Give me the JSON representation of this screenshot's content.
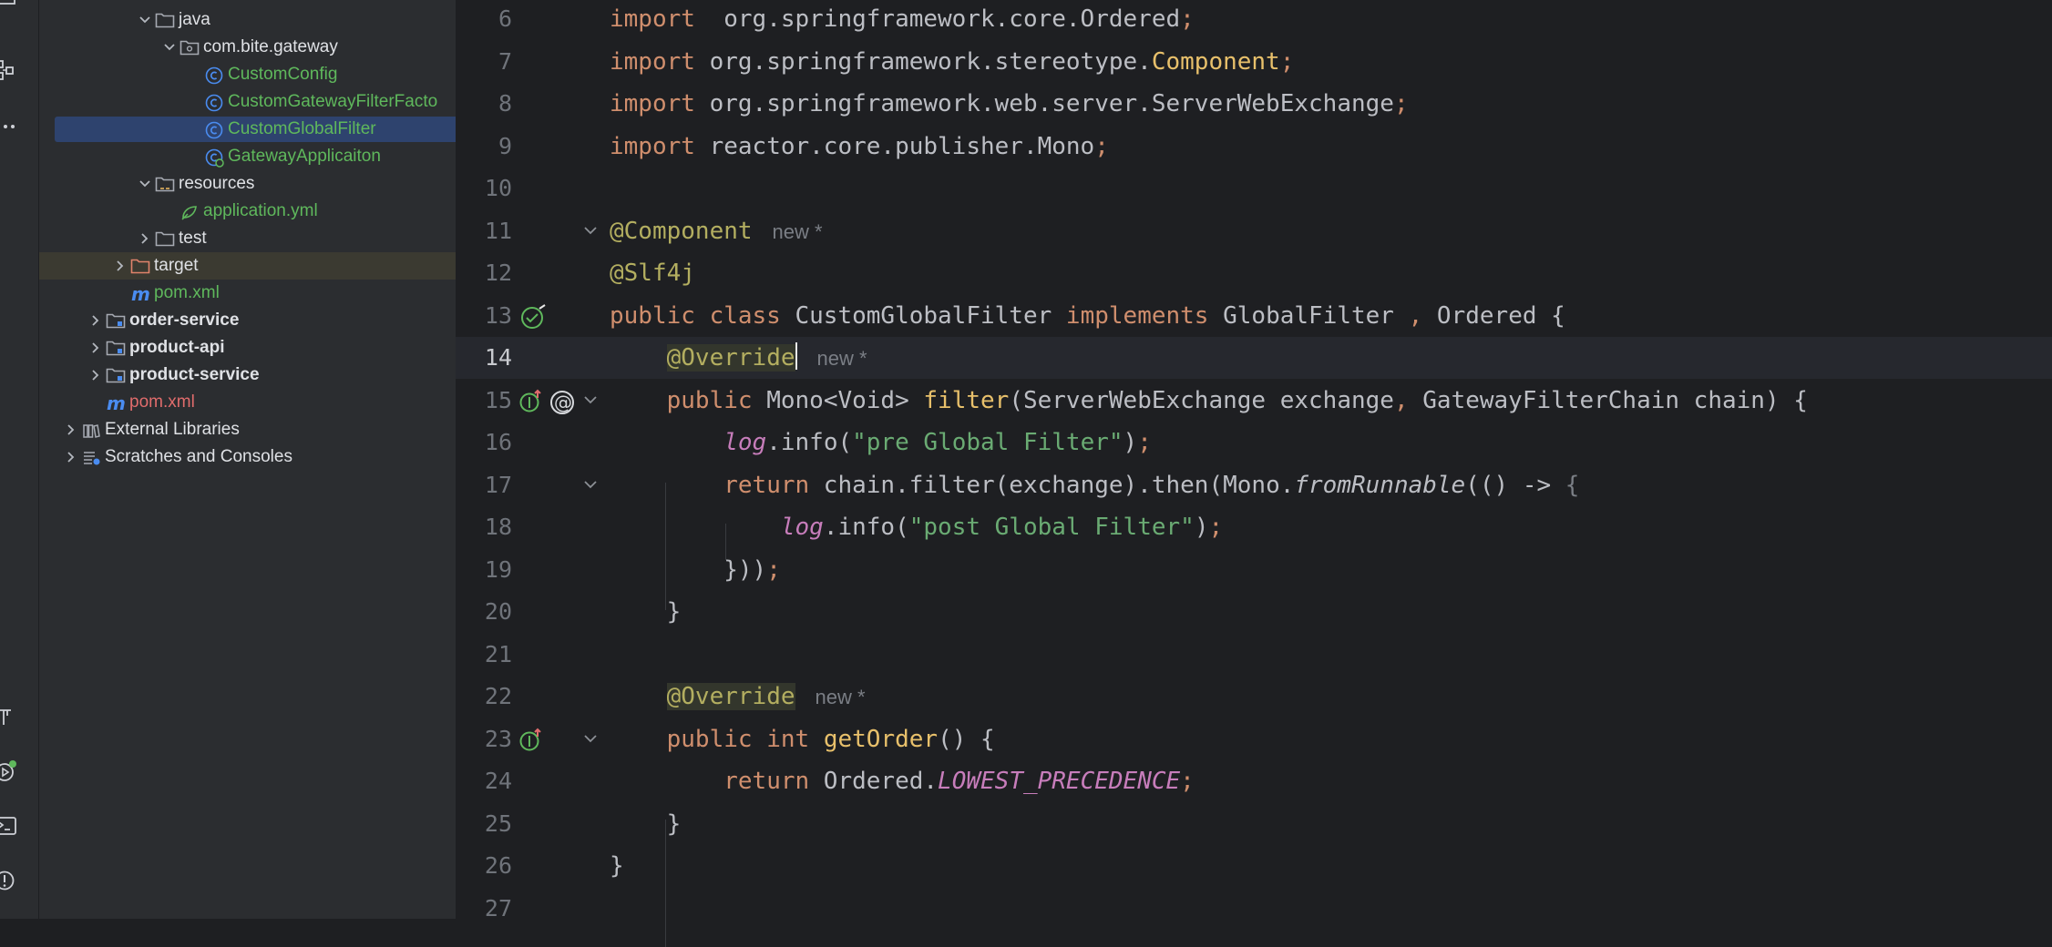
{
  "project_tree": [
    {
      "label": "java",
      "indent": 1,
      "chevron": "down",
      "icon": "folder-icon",
      "style": ""
    },
    {
      "label": "com.bite.gateway",
      "indent": 2,
      "chevron": "down",
      "icon": "package-icon",
      "style": ""
    },
    {
      "label": "CustomConfig",
      "indent": 3,
      "chevron": "",
      "icon": "class-icon",
      "style": "green"
    },
    {
      "label": "CustomGatewayFilterFacto",
      "indent": 3,
      "chevron": "",
      "icon": "class-icon",
      "style": "green"
    },
    {
      "label": "CustomGlobalFilter",
      "indent": 3,
      "chevron": "",
      "icon": "class-icon",
      "style": "green",
      "selected": true
    },
    {
      "label": "GatewayApplicaiton",
      "indent": 3,
      "chevron": "",
      "icon": "spring-class-icon",
      "style": "green"
    },
    {
      "label": "resources",
      "indent": 1,
      "chevron": "down",
      "icon": "resources-folder-icon",
      "style": ""
    },
    {
      "label": "application.yml",
      "indent": 2,
      "chevron": "",
      "icon": "yaml-icon",
      "style": "green"
    },
    {
      "label": "test",
      "indent": 1,
      "chevron": "right",
      "icon": "folder-icon",
      "style": ""
    },
    {
      "label": "target",
      "indent": 0,
      "chevron": "right",
      "icon": "excluded-folder-icon",
      "style": "",
      "excluded": true
    },
    {
      "label": "pom.xml",
      "indent": 0,
      "chevron": "",
      "icon": "maven-icon",
      "style": "green"
    },
    {
      "label": "order-service",
      "indent": -1,
      "chevron": "right",
      "icon": "module-folder-icon",
      "style": "bold"
    },
    {
      "label": "product-api",
      "indent": -1,
      "chevron": "right",
      "icon": "module-folder-icon",
      "style": "bold"
    },
    {
      "label": "product-service",
      "indent": -1,
      "chevron": "right",
      "icon": "module-folder-icon",
      "style": "bold"
    },
    {
      "label": "pom.xml",
      "indent": -1,
      "chevron": "",
      "icon": "maven-icon",
      "style": "red"
    },
    {
      "label": "External Libraries",
      "indent": -2,
      "chevron": "right",
      "icon": "libraries-icon",
      "style": ""
    },
    {
      "label": "Scratches and Consoles",
      "indent": -2,
      "chevron": "right",
      "icon": "scratches-icon",
      "style": ""
    }
  ],
  "toolstrip": [
    "project-tool-icon",
    "structure-icon",
    "more-icon",
    "build-icon",
    "run-services-icon",
    "terminal-icon",
    "problems-icon"
  ],
  "code_lines": [
    {
      "n": "6",
      "tokens": [
        [
          "kw",
          "import"
        ],
        [
          "",
          "  org.springframework.core.Ordered"
        ],
        [
          "semi",
          ";"
        ]
      ]
    },
    {
      "n": "7",
      "tokens": [
        [
          "kw",
          "import"
        ],
        [
          "",
          " org.springframework.stereotype."
        ],
        [
          "mth",
          "Component"
        ],
        [
          "semi",
          ";"
        ]
      ]
    },
    {
      "n": "8",
      "tokens": [
        [
          "kw",
          "import"
        ],
        [
          "",
          " org.springframework.web.server.ServerWebExchange"
        ],
        [
          "semi",
          ";"
        ]
      ]
    },
    {
      "n": "9",
      "tokens": [
        [
          "kw",
          "import"
        ],
        [
          "",
          " reactor.core.publisher.Mono"
        ],
        [
          "semi",
          ";"
        ]
      ]
    },
    {
      "n": "10",
      "tokens": []
    },
    {
      "n": "11",
      "tokens": [
        [
          "ann",
          "@Component"
        ],
        [
          "hint",
          "new *"
        ]
      ],
      "fold": true
    },
    {
      "n": "12",
      "tokens": [
        [
          "ann",
          "@Slf4j"
        ]
      ]
    },
    {
      "n": "13",
      "tokens": [
        [
          "kw",
          "public class"
        ],
        [
          "",
          " CustomGlobalFilter "
        ],
        [
          "kw",
          "implements"
        ],
        [
          "",
          " GlobalFilter "
        ],
        [
          "kw",
          ","
        ],
        [
          "",
          " Ordered {"
        ]
      ],
      "gutter": "bean-icon"
    },
    {
      "n": "14",
      "tokens": [
        [
          "",
          "    "
        ],
        [
          "ann ovr",
          "@Override"
        ],
        [
          "caret",
          ""
        ],
        [
          "hint",
          "new *"
        ]
      ],
      "current": true
    },
    {
      "n": "15",
      "tokens": [
        [
          "",
          "    "
        ],
        [
          "kw",
          "public"
        ],
        [
          "",
          " Mono<Void> "
        ],
        [
          "mth",
          "filter"
        ],
        [
          "",
          "(ServerWebExchange exchange"
        ],
        [
          "kw",
          ","
        ],
        [
          "",
          " GatewayFilterChain chain) {"
        ]
      ],
      "gutter": "implements-override-icon",
      "fold": true
    },
    {
      "n": "16",
      "tokens": [
        [
          "",
          "        "
        ],
        [
          "logv",
          "log"
        ],
        [
          "",
          ".info("
        ],
        [
          "str",
          "\"pre Global Filter\""
        ],
        [
          "",
          ")"
        ],
        [
          "semi",
          ";"
        ]
      ]
    },
    {
      "n": "17",
      "tokens": [
        [
          "",
          "        "
        ],
        [
          "kw",
          "return"
        ],
        [
          "",
          " chain.filter(exchange).then(Mono."
        ],
        [
          "itf",
          "fromRunnable"
        ],
        [
          "",
          "(() -> "
        ],
        [
          "gry",
          "{"
        ]
      ],
      "fold": true
    },
    {
      "n": "18",
      "tokens": [
        [
          "",
          "            "
        ],
        [
          "logv",
          "log"
        ],
        [
          "",
          ".info("
        ],
        [
          "str",
          "\"post Global Filter\""
        ],
        [
          "",
          ")"
        ],
        [
          "semi",
          ";"
        ]
      ]
    },
    {
      "n": "19",
      "tokens": [
        [
          "",
          "        })"
        ],
        [
          "",
          ")"
        ],
        [
          "semi",
          ";"
        ]
      ]
    },
    {
      "n": "20",
      "tokens": [
        [
          "",
          "    }"
        ]
      ]
    },
    {
      "n": "21",
      "tokens": []
    },
    {
      "n": "22",
      "tokens": [
        [
          "",
          "    "
        ],
        [
          "ann ovr",
          "@Override"
        ],
        [
          "hint",
          "new *"
        ]
      ]
    },
    {
      "n": "23",
      "tokens": [
        [
          "",
          "    "
        ],
        [
          "kw",
          "public int"
        ],
        [
          "",
          " "
        ],
        [
          "mth",
          "getOrder"
        ],
        [
          "",
          "() {"
        ]
      ],
      "gutter": "implements-icon",
      "fold": true
    },
    {
      "n": "24",
      "tokens": [
        [
          "",
          "        "
        ],
        [
          "kw",
          "return"
        ],
        [
          "",
          " Ordered."
        ],
        [
          "stat",
          "LOWEST_PRECEDENCE"
        ],
        [
          "semi",
          ";"
        ]
      ]
    },
    {
      "n": "25",
      "tokens": [
        [
          "",
          "    }"
        ]
      ]
    },
    {
      "n": "26",
      "tokens": [
        [
          "",
          "}"
        ]
      ]
    },
    {
      "n": "27",
      "tokens": []
    }
  ]
}
